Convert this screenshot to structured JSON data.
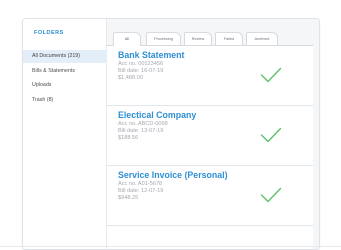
{
  "sidebar": {
    "title": "FOLDERS",
    "items": [
      {
        "label": "All Documents (219)",
        "active": true
      },
      {
        "label": "Bills & Statements"
      },
      {
        "label": "Uploads"
      },
      {
        "label": "Trash (8)"
      }
    ]
  },
  "tabs": [
    "All",
    "Processing",
    "Review",
    "Failed",
    "Archived"
  ],
  "documents": [
    {
      "title": "Bank Statement",
      "account": "Acc no. 00123456",
      "bill_date": "Bill date: 16-07-19",
      "amount": "$1,488.00"
    },
    {
      "title": "Electical Company",
      "account": "Acc no. ABCD-0098",
      "bill_date": "Bill date: 13-07-19",
      "amount": "$188.56"
    },
    {
      "title": "Service Invoice (Personal)",
      "account": "Acc no. A01-5678",
      "bill_date": "Bill date: 12-07-19",
      "amount": "$948.25"
    }
  ],
  "colors": {
    "accent": "#2d8fd4",
    "check": "#5cc16b",
    "active_row": "#e4eef8"
  },
  "icons": {
    "status": "checkmark-icon"
  }
}
